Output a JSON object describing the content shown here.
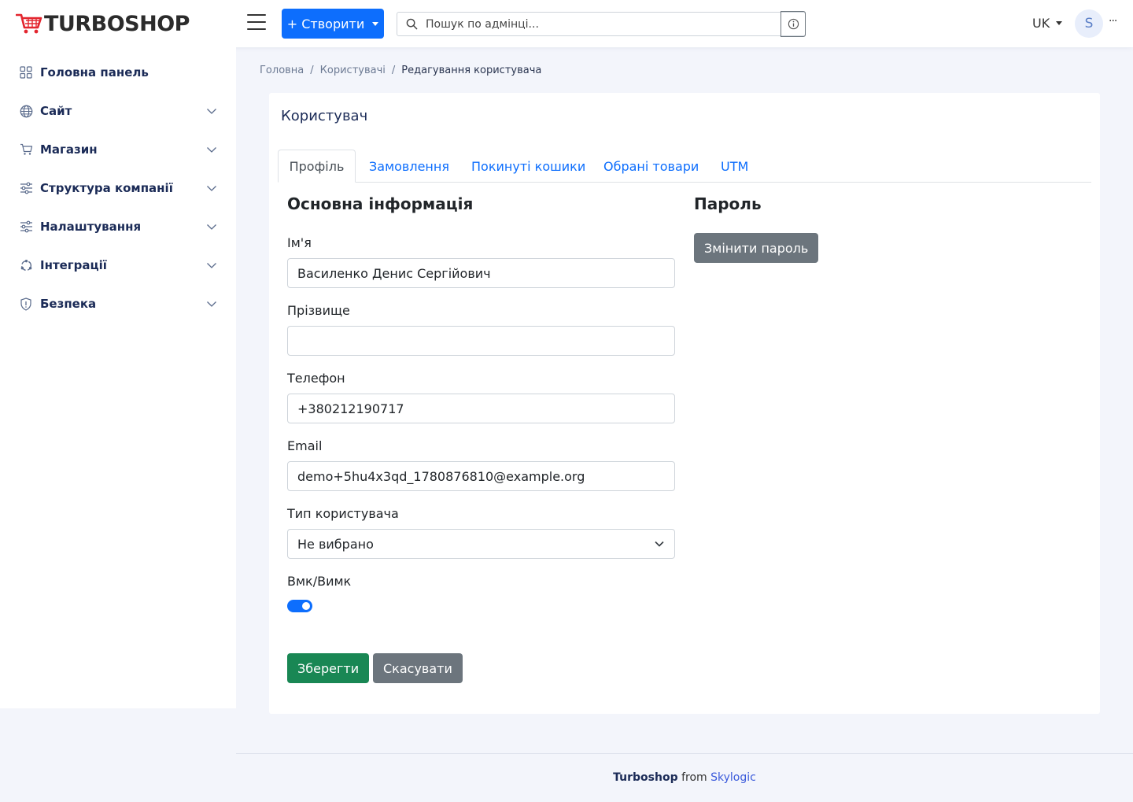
{
  "header": {
    "logo_text": "TURBOSHOP",
    "create_label": "+ Створити",
    "search_placeholder": "Пошук по адмінці...",
    "language": "UK",
    "avatar_initial": "S",
    "more_label": "···",
    "brand_color": "#e3262f"
  },
  "sidebar": {
    "items": [
      {
        "label": "Головна панель",
        "icon": "dashboard-icon",
        "has_submenu": false
      },
      {
        "label": "Сайт",
        "icon": "globe-icon",
        "has_submenu": true
      },
      {
        "label": "Магазин",
        "icon": "cart-icon",
        "has_submenu": true
      },
      {
        "label": "Структура компанії",
        "icon": "sliders-icon",
        "has_submenu": true
      },
      {
        "label": "Налаштування",
        "icon": "sliders-icon",
        "has_submenu": true
      },
      {
        "label": "Інтеграції",
        "icon": "integration-icon",
        "has_submenu": true
      },
      {
        "label": "Безпека",
        "icon": "shield-icon",
        "has_submenu": true
      }
    ]
  },
  "breadcrumb": {
    "home": "Головна",
    "users": "Користувачі",
    "current": "Редагування користувача"
  },
  "card": {
    "title": "Користувач",
    "tabs": [
      "Профіль",
      "Замовлення",
      "Покинуті кошики",
      "Обрані товари",
      "UTM"
    ],
    "active_tab": "Профіль",
    "basic_info_title": "Основна інформація",
    "password_title": "Пароль",
    "change_password_label": "Змінити пароль",
    "fields": {
      "name_label": "Ім'я",
      "name_value": "Василенко Денис Сергійович",
      "surname_label": "Прізвище",
      "surname_value": "",
      "phone_label": "Телефон",
      "phone_value": "+380212190717",
      "email_label": "Email",
      "email_value": "demo+5hu4x3qd_1780876810@example.org",
      "user_type_label": "Тип користувача",
      "user_type_value": "Не вибрано",
      "enabled_label": "Вмк/Вимк",
      "enabled": true
    },
    "save_label": "Зберегти",
    "cancel_label": "Скасувати"
  },
  "footer": {
    "brand": "Turboshop",
    "from": "from",
    "company": "Skylogic"
  }
}
